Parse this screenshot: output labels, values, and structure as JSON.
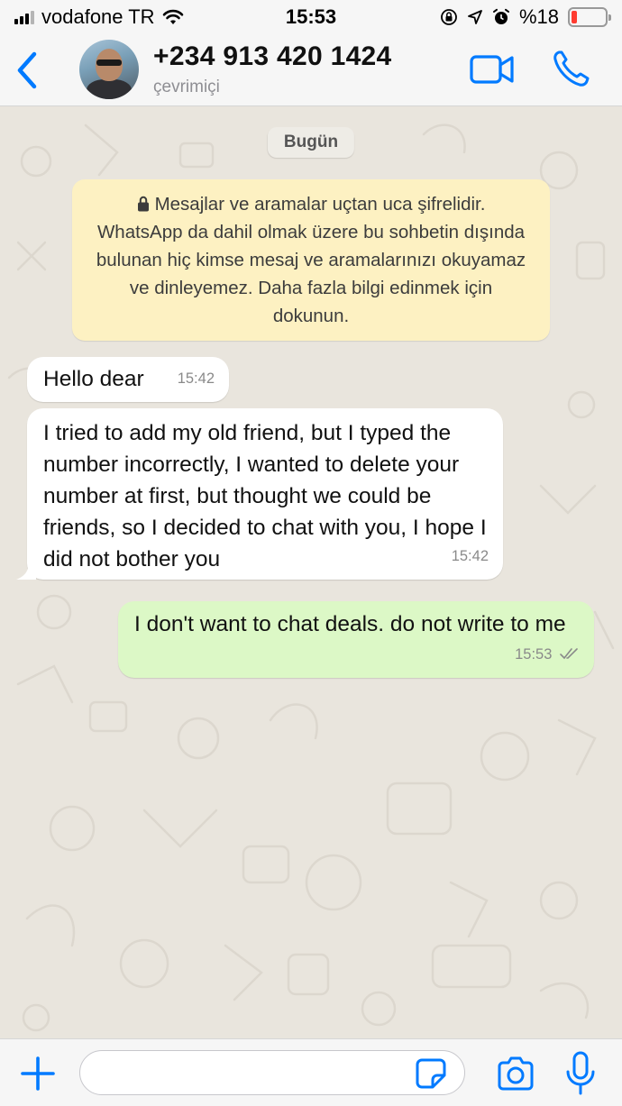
{
  "status_bar": {
    "carrier": "vodafone TR",
    "time": "15:53",
    "battery_percent": "%18",
    "battery_level": 0.18
  },
  "header": {
    "contact_name": "+234 913 420 1424",
    "contact_status": "çevrimiçi",
    "icons": [
      "chevron-left-icon",
      "video-camera-icon",
      "phone-icon"
    ]
  },
  "chat": {
    "date_label": "Bugün",
    "encryption_notice": "Mesajlar ve aramalar uçtan uca şifrelidir. WhatsApp da dahil olmak üzere bu sohbetin dışında bulunan hiç kimse mesaj ve aramalarınızı okuyamaz ve dinleyemez. Daha fazla bilgi edinmek için dokunun.",
    "messages": [
      {
        "direction": "incoming",
        "text": "Hello dear",
        "time": "15:42"
      },
      {
        "direction": "incoming",
        "text": "I tried to add my old friend, but I typed the number incorrectly, I wanted to delete your number at first, but thought we could be friends, so I decided to chat with you, I hope I did not bother you",
        "time": "15:42"
      },
      {
        "direction": "outgoing",
        "text": "I don't want to chat deals. do not write to me",
        "time": "15:53",
        "status": "read"
      }
    ]
  },
  "input_bar": {
    "placeholder": "",
    "icons": [
      "plus-icon",
      "sticker-icon",
      "camera-icon",
      "microphone-icon"
    ]
  },
  "colors": {
    "accent": "#007aff",
    "outgoing_bubble": "#dcf8c6",
    "incoming_bubble": "#ffffff",
    "notice_bg": "#fdf1c2",
    "chat_bg": "#e9e5dd"
  }
}
